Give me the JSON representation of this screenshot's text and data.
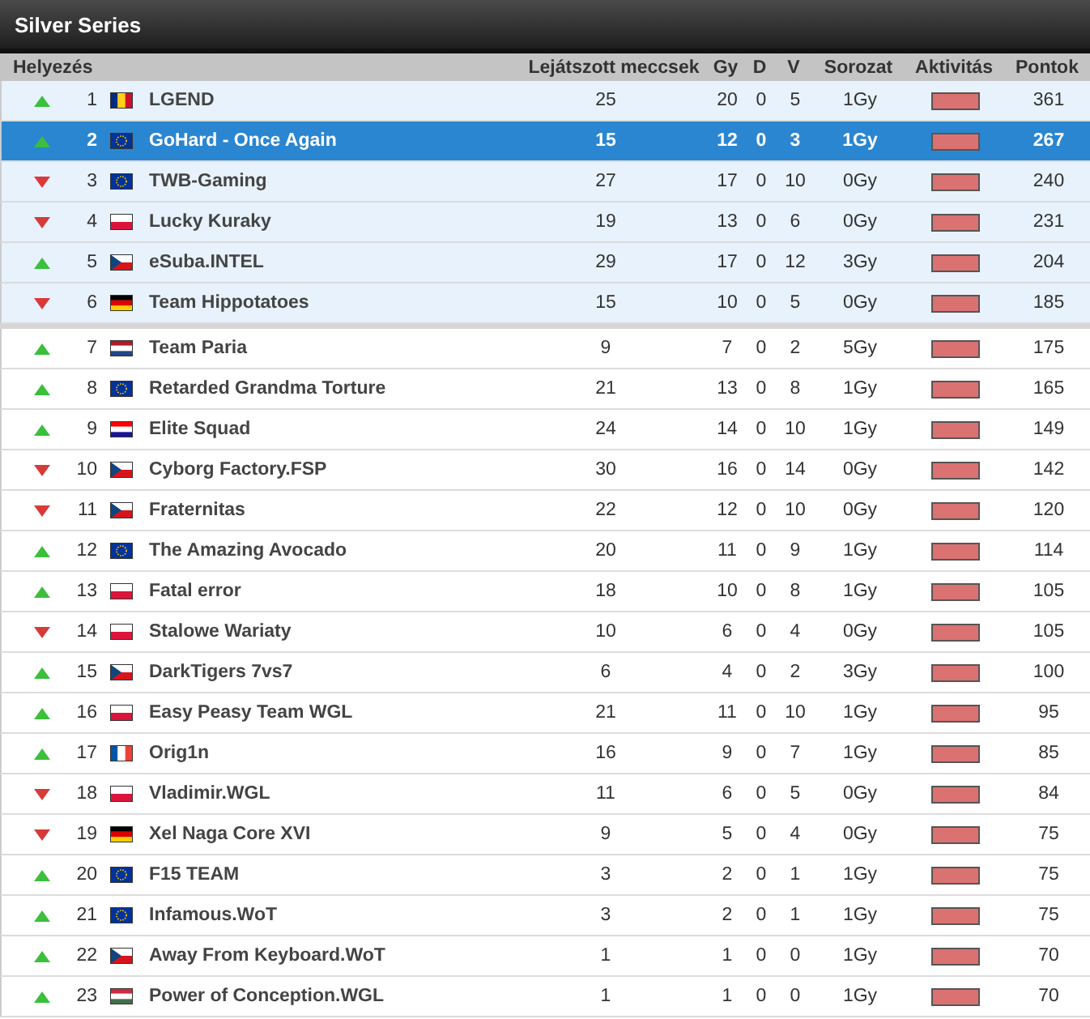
{
  "title": "Silver Series",
  "columns": [
    "Helyezés",
    "Lejátszott meccsek",
    "Gy",
    "D",
    "V",
    "Sorozat",
    "Aktivitás",
    "Pontok"
  ],
  "rows": [
    {
      "trend": {
        "kind": "up"
      },
      "rank": "1",
      "flag": {
        "kind": "ro"
      },
      "name": "LGEND",
      "played": "25",
      "gy": "20",
      "d": "0",
      "v": "5",
      "streak": "1Gy",
      "points": "361",
      "promoted": true,
      "selected": false
    },
    {
      "trend": {
        "kind": "up"
      },
      "rank": "2",
      "flag": {
        "kind": "eu"
      },
      "name": "GoHard - Once Again",
      "played": "15",
      "gy": "12",
      "d": "0",
      "v": "3",
      "streak": "1Gy",
      "points": "267",
      "promoted": true,
      "selected": true
    },
    {
      "trend": {
        "kind": "down"
      },
      "rank": "3",
      "flag": {
        "kind": "eu"
      },
      "name": "TWB-Gaming",
      "played": "27",
      "gy": "17",
      "d": "0",
      "v": "10",
      "streak": "0Gy",
      "points": "240",
      "promoted": true,
      "selected": false
    },
    {
      "trend": {
        "kind": "down"
      },
      "rank": "4",
      "flag": {
        "kind": "pl"
      },
      "name": "Lucky Kuraky",
      "played": "19",
      "gy": "13",
      "d": "0",
      "v": "6",
      "streak": "0Gy",
      "points": "231",
      "promoted": true,
      "selected": false
    },
    {
      "trend": {
        "kind": "up"
      },
      "rank": "5",
      "flag": {
        "kind": "cz"
      },
      "name": "eSuba.INTEL",
      "played": "29",
      "gy": "17",
      "d": "0",
      "v": "12",
      "streak": "3Gy",
      "points": "204",
      "promoted": true,
      "selected": false
    },
    {
      "trend": {
        "kind": "down"
      },
      "rank": "6",
      "flag": {
        "kind": "de"
      },
      "name": "Team Hippotatoes",
      "played": "15",
      "gy": "10",
      "d": "0",
      "v": "5",
      "streak": "0Gy",
      "points": "185",
      "promoted": true,
      "selected": false
    },
    {
      "trend": {
        "kind": "up"
      },
      "rank": "7",
      "flag": {
        "kind": "nl"
      },
      "name": "Team Paria",
      "played": "9",
      "gy": "7",
      "d": "0",
      "v": "2",
      "streak": "5Gy",
      "points": "175",
      "promoted": false,
      "selected": false
    },
    {
      "trend": {
        "kind": "up"
      },
      "rank": "8",
      "flag": {
        "kind": "eu"
      },
      "name": "Retarded Grandma Torture",
      "played": "21",
      "gy": "13",
      "d": "0",
      "v": "8",
      "streak": "1Gy",
      "points": "165",
      "promoted": false,
      "selected": false
    },
    {
      "trend": {
        "kind": "up"
      },
      "rank": "9",
      "flag": {
        "kind": "hr"
      },
      "name": "Elite Squad",
      "played": "24",
      "gy": "14",
      "d": "0",
      "v": "10",
      "streak": "1Gy",
      "points": "149",
      "promoted": false,
      "selected": false
    },
    {
      "trend": {
        "kind": "down"
      },
      "rank": "10",
      "flag": {
        "kind": "cz"
      },
      "name": "Cyborg Factory.FSP",
      "played": "30",
      "gy": "16",
      "d": "0",
      "v": "14",
      "streak": "0Gy",
      "points": "142",
      "promoted": false,
      "selected": false
    },
    {
      "trend": {
        "kind": "down"
      },
      "rank": "11",
      "flag": {
        "kind": "cz"
      },
      "name": "Fraternitas",
      "played": "22",
      "gy": "12",
      "d": "0",
      "v": "10",
      "streak": "0Gy",
      "points": "120",
      "promoted": false,
      "selected": false
    },
    {
      "trend": {
        "kind": "up"
      },
      "rank": "12",
      "flag": {
        "kind": "eu"
      },
      "name": "The Amazing Avocado",
      "played": "20",
      "gy": "11",
      "d": "0",
      "v": "9",
      "streak": "1Gy",
      "points": "114",
      "promoted": false,
      "selected": false
    },
    {
      "trend": {
        "kind": "up"
      },
      "rank": "13",
      "flag": {
        "kind": "pl"
      },
      "name": "Fatal error",
      "played": "18",
      "gy": "10",
      "d": "0",
      "v": "8",
      "streak": "1Gy",
      "points": "105",
      "promoted": false,
      "selected": false
    },
    {
      "trend": {
        "kind": "down"
      },
      "rank": "14",
      "flag": {
        "kind": "pl"
      },
      "name": "Stalowe Wariaty",
      "played": "10",
      "gy": "6",
      "d": "0",
      "v": "4",
      "streak": "0Gy",
      "points": "105",
      "promoted": false,
      "selected": false
    },
    {
      "trend": {
        "kind": "up"
      },
      "rank": "15",
      "flag": {
        "kind": "cz"
      },
      "name": "DarkTigers 7vs7",
      "played": "6",
      "gy": "4",
      "d": "0",
      "v": "2",
      "streak": "3Gy",
      "points": "100",
      "promoted": false,
      "selected": false
    },
    {
      "trend": {
        "kind": "up"
      },
      "rank": "16",
      "flag": {
        "kind": "pl"
      },
      "name": "Easy Peasy Team WGL",
      "played": "21",
      "gy": "11",
      "d": "0",
      "v": "10",
      "streak": "1Gy",
      "points": "95",
      "promoted": false,
      "selected": false
    },
    {
      "trend": {
        "kind": "up"
      },
      "rank": "17",
      "flag": {
        "kind": "fr"
      },
      "name": "Orig1n",
      "played": "16",
      "gy": "9",
      "d": "0",
      "v": "7",
      "streak": "1Gy",
      "points": "85",
      "promoted": false,
      "selected": false
    },
    {
      "trend": {
        "kind": "down"
      },
      "rank": "18",
      "flag": {
        "kind": "pl"
      },
      "name": "Vladimir.WGL",
      "played": "11",
      "gy": "6",
      "d": "0",
      "v": "5",
      "streak": "0Gy",
      "points": "84",
      "promoted": false,
      "selected": false
    },
    {
      "trend": {
        "kind": "down"
      },
      "rank": "19",
      "flag": {
        "kind": "de"
      },
      "name": "Xel Naga Core XVI",
      "played": "9",
      "gy": "5",
      "d": "0",
      "v": "4",
      "streak": "0Gy",
      "points": "75",
      "promoted": false,
      "selected": false
    },
    {
      "trend": {
        "kind": "up"
      },
      "rank": "20",
      "flag": {
        "kind": "eu"
      },
      "name": "F15 TEAM",
      "played": "3",
      "gy": "2",
      "d": "0",
      "v": "1",
      "streak": "1Gy",
      "points": "75",
      "promoted": false,
      "selected": false
    },
    {
      "trend": {
        "kind": "up"
      },
      "rank": "21",
      "flag": {
        "kind": "eu"
      },
      "name": "Infamous.WoT",
      "played": "3",
      "gy": "2",
      "d": "0",
      "v": "1",
      "streak": "1Gy",
      "points": "75",
      "promoted": false,
      "selected": false
    },
    {
      "trend": {
        "kind": "up"
      },
      "rank": "22",
      "flag": {
        "kind": "cz"
      },
      "name": "Away From Keyboard.WoT",
      "played": "1",
      "gy": "1",
      "d": "0",
      "v": "0",
      "streak": "1Gy",
      "points": "70",
      "promoted": false,
      "selected": false
    },
    {
      "trend": {
        "kind": "up"
      },
      "rank": "23",
      "flag": {
        "kind": "hu"
      },
      "name": "Power of Conception.WGL",
      "played": "1",
      "gy": "1",
      "d": "0",
      "v": "0",
      "streak": "1Gy",
      "points": "70",
      "promoted": false,
      "selected": false
    }
  ]
}
